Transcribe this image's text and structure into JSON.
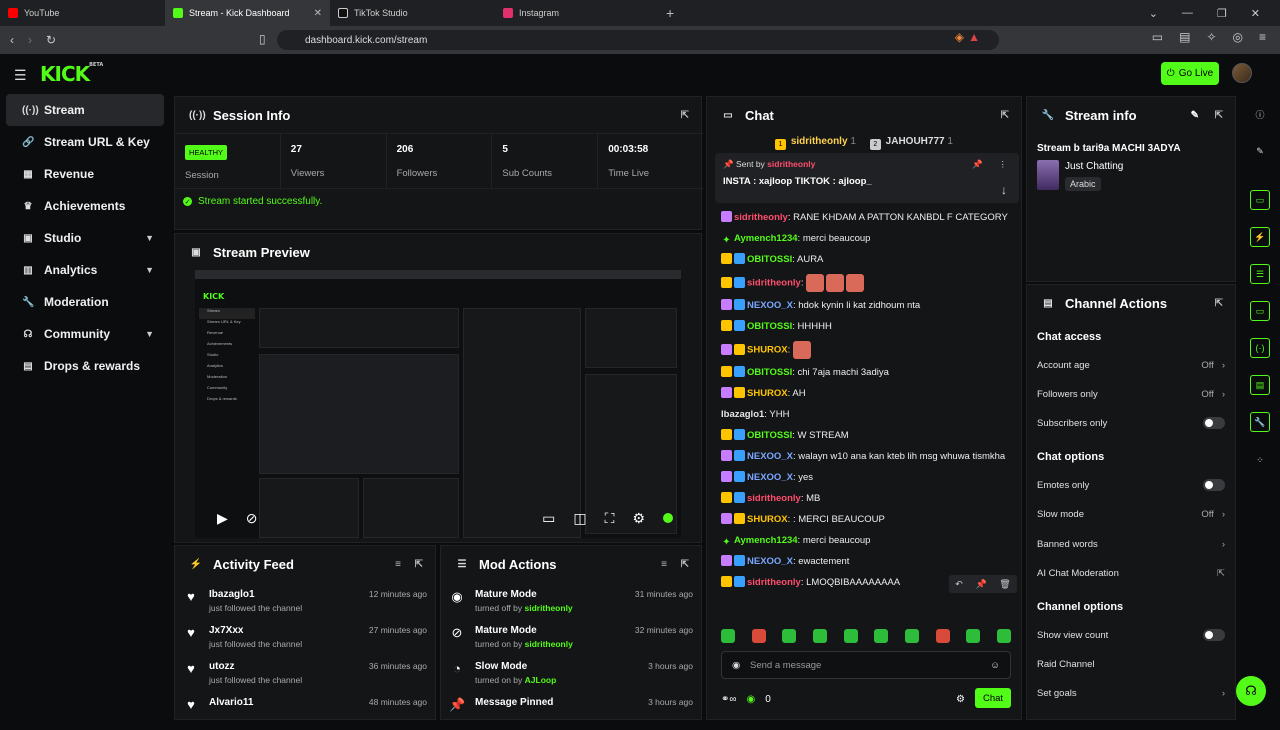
{
  "browser": {
    "tabs": [
      {
        "label": "YouTube",
        "color": "#ff0000"
      },
      {
        "label": "Stream - Kick Dashboard",
        "color": "#53fc18"
      },
      {
        "label": "TikTok Studio",
        "color": "#ffffff"
      },
      {
        "label": "Instagram",
        "color": "#e1306c"
      }
    ],
    "url": "dashboard.kick.com/stream"
  },
  "header": {
    "logo": "KICK",
    "logo_badge": "BETA",
    "go_live": "Go Live"
  },
  "sidebar": {
    "items": [
      {
        "label": "Stream",
        "icon": "stream-icon"
      },
      {
        "label": "Stream URL & Key",
        "icon": "link-icon"
      },
      {
        "label": "Revenue",
        "icon": "revenue-icon"
      },
      {
        "label": "Achievements",
        "icon": "trophy-icon"
      },
      {
        "label": "Studio",
        "icon": "studio-icon",
        "expandable": true
      },
      {
        "label": "Analytics",
        "icon": "analytics-icon",
        "expandable": true
      },
      {
        "label": "Moderation",
        "icon": "wrench-icon"
      },
      {
        "label": "Community",
        "icon": "community-icon",
        "expandable": true
      },
      {
        "label": "Drops & rewards",
        "icon": "gift-icon"
      }
    ]
  },
  "session": {
    "title": "Session Info",
    "status": "HEALTHY",
    "status_label": "Session",
    "stats": [
      {
        "value": "27",
        "label": "Viewers"
      },
      {
        "value": "206",
        "label": "Followers"
      },
      {
        "value": "5",
        "label": "Sub Counts"
      },
      {
        "value": "00:03:58",
        "label": "Time Live"
      }
    ],
    "message": "Stream started successfully."
  },
  "preview": {
    "title": "Stream Preview"
  },
  "activity": {
    "title": "Activity Feed",
    "items": [
      {
        "name": "Ibazaglo1",
        "text": "just followed the channel",
        "time": "12 minutes ago"
      },
      {
        "name": "Jx7Xxx",
        "text": "just followed the channel",
        "time": "27 minutes ago"
      },
      {
        "name": "utozz",
        "text": "just followed the channel",
        "time": "36 minutes ago"
      },
      {
        "name": "Alvario11",
        "text": "",
        "time": "48 minutes ago"
      }
    ]
  },
  "modactions": {
    "title": "Mod Actions",
    "items": [
      {
        "name": "Mature Mode",
        "text": "turned off by",
        "by": "sidritheonly",
        "time": "31 minutes ago"
      },
      {
        "name": "Mature Mode",
        "text": "turned on by",
        "by": "sidritheonly",
        "time": "32 minutes ago"
      },
      {
        "name": "Slow Mode",
        "text": "turned on by",
        "by": "AJLoop",
        "time": "3 hours ago"
      },
      {
        "name": "Message Pinned",
        "text": "",
        "by": "",
        "time": "3 hours ago"
      }
    ]
  },
  "chat": {
    "title": "Chat",
    "gifters": [
      {
        "rank": "1",
        "name": "sidritheonly",
        "count": "1"
      },
      {
        "rank": "2",
        "name": "JAHOUH777",
        "count": "1"
      }
    ],
    "pinned": {
      "sent_by_label": "Sent by",
      "sent_by": "sidritheonly",
      "text": "INSTA : xajloop TIKTOK : ajloop_"
    },
    "messages": [
      {
        "user": "sidritheonly",
        "color": "#ff4d6d",
        "badges": [
          "gift"
        ],
        "text": "RANE KHDAM A PATTON KANBDL F CATEGORY"
      },
      {
        "user": "Aymench1234",
        "color": "#53fc18",
        "badges": [
          "star"
        ],
        "text": "merci beaucoup"
      },
      {
        "user": "OBITOSSI",
        "color": "#53fc18",
        "badges": [
          "crown",
          "sub"
        ],
        "text": "AURA"
      },
      {
        "user": "sidritheonly",
        "color": "#ff4d6d",
        "badges": [
          "crown",
          "sub"
        ],
        "text": "",
        "emotes": 3
      },
      {
        "user": "NEXOO_X",
        "color": "#7aa7ff",
        "badges": [
          "gift",
          "sub"
        ],
        "text": "hdok kynin li kat zidhoum nta"
      },
      {
        "user": "OBITOSSI",
        "color": "#53fc18",
        "badges": [
          "crown",
          "sub"
        ],
        "text": "HHHHH"
      },
      {
        "user": "SHUROX",
        "color": "#ffc400",
        "badges": [
          "gift",
          "crown"
        ],
        "text": "",
        "emotes": 1
      },
      {
        "user": "OBITOSSI",
        "color": "#53fc18",
        "badges": [
          "crown",
          "sub"
        ],
        "text": "chi 7aja machi 3adiya"
      },
      {
        "user": "SHUROX",
        "color": "#ffc400",
        "badges": [
          "gift",
          "crown"
        ],
        "text": "AH"
      },
      {
        "user": "Ibazaglo1",
        "color": "#e6e6e6",
        "badges": [],
        "text": "YHH"
      },
      {
        "user": "OBITOSSI",
        "color": "#53fc18",
        "badges": [
          "crown",
          "sub"
        ],
        "text": "W STREAM"
      },
      {
        "user": "NEXOO_X",
        "color": "#7aa7ff",
        "badges": [
          "gift",
          "sub"
        ],
        "text": "walayn w10 ana kan kteb lih msg whuwa tismkha"
      },
      {
        "user": "NEXOO_X",
        "color": "#7aa7ff",
        "badges": [
          "gift",
          "sub"
        ],
        "text": "yes"
      },
      {
        "user": "sidritheonly",
        "color": "#ff4d6d",
        "badges": [
          "crown",
          "sub"
        ],
        "text": "MB"
      },
      {
        "user": "SHUROX",
        "color": "#ffc400",
        "badges": [
          "gift",
          "crown"
        ],
        "text": ": MERCI BEAUCOUP"
      },
      {
        "user": "Aymench1234",
        "color": "#53fc18",
        "badges": [
          "star"
        ],
        "text": "merci beaucoup"
      },
      {
        "user": "NEXOO_X",
        "color": "#7aa7ff",
        "badges": [
          "gift",
          "sub"
        ],
        "text": "ewactement"
      },
      {
        "user": "sidritheonly",
        "color": "#ff4d6d",
        "badges": [
          "crown",
          "sub"
        ],
        "text": "LMOQBIBAAAAAAAA"
      }
    ],
    "placeholder": "Send a message",
    "points": "0",
    "send_label": "Chat"
  },
  "streaminfo": {
    "title": "Stream info",
    "stream_title": "Stream b tari9a MACHI 3ADYA",
    "category": "Just Chatting",
    "tag": "Arabic"
  },
  "channel": {
    "title": "Channel Actions",
    "chat_access": "Chat access",
    "account_age": {
      "label": "Account age",
      "value": "Off"
    },
    "followers_only": {
      "label": "Followers only",
      "value": "Off"
    },
    "subscribers_only": "Subscribers only",
    "chat_options": "Chat options",
    "emotes_only": "Emotes only",
    "slow_mode": {
      "label": "Slow mode",
      "value": "Off"
    },
    "banned_words": "Banned words",
    "ai_mod": "AI Chat Moderation",
    "channel_options": "Channel options",
    "show_view_count": "Show view count",
    "raid": "Raid Channel",
    "goals": "Set goals"
  },
  "preview_mini": {
    "sidebar": [
      "Stream",
      "Stream URL & Key",
      "Revenue",
      "Achievements",
      "Studio",
      "Analytics",
      "Moderation",
      "Community",
      "Drops & rewards"
    ]
  }
}
